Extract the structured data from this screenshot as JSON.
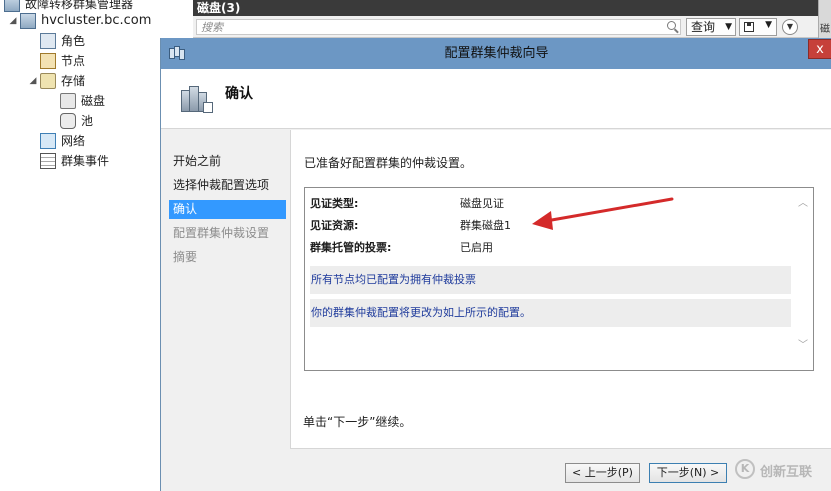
{
  "tree": {
    "root_partial": "故障转移群集管理器",
    "cluster": "hvcluster.bc.com",
    "roles": "角色",
    "nodes": "节点",
    "storage": "存储",
    "disks": "磁盘",
    "pools": "池",
    "networks": "网络",
    "cluster_events": "群集事件"
  },
  "background_pane": {
    "title": "磁盘(3)",
    "search_placeholder": "搜索",
    "query_label": "查询",
    "right_edge_glyph": "磁"
  },
  "dialog": {
    "title": "配置群集仲裁向导",
    "close_label": "x",
    "page_title": "确认",
    "steps": [
      {
        "label": "开始之前",
        "state": "done"
      },
      {
        "label": "选择仲裁配置选项",
        "state": "done"
      },
      {
        "label": "确认",
        "state": "active"
      },
      {
        "label": "配置群集仲裁设置",
        "state": "disabled"
      },
      {
        "label": "摘要",
        "state": "disabled"
      }
    ],
    "intro": "已准备好配置群集的仲裁设置。",
    "summary": {
      "rows": [
        {
          "key": "见证类型:",
          "value": "磁盘见证"
        },
        {
          "key": "见证资源:",
          "value": "群集磁盘1"
        },
        {
          "key": "群集托管的投票:",
          "value": "已启用"
        }
      ],
      "notices": [
        "所有节点均已配置为拥有仲裁投票",
        "你的群集仲裁配置将更改为如上所示的配置。"
      ]
    },
    "continue_text": "单击“下一步”继续。",
    "prev_button": "< 上一步(P)",
    "next_button": "下一步(N) >"
  },
  "annotation": {
    "arrow_color": "#d42a2a"
  },
  "watermark": {
    "text": "创新互联",
    "logo": "K"
  }
}
